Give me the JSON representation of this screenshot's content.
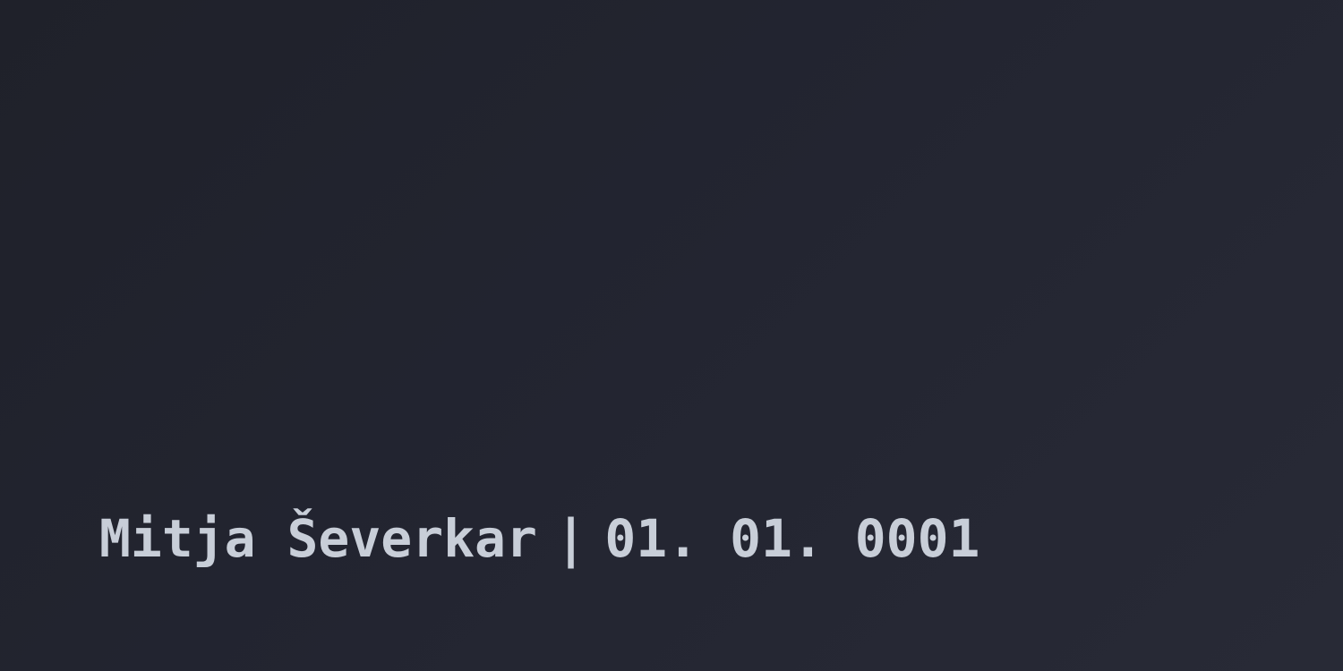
{
  "byline": {
    "author": "Mitja Ševerkar",
    "separator": "|",
    "date": "01. 01. 0001"
  },
  "colors": {
    "background_start": "#1f212a",
    "background_end": "#282a36",
    "text": "#c8ced8"
  }
}
